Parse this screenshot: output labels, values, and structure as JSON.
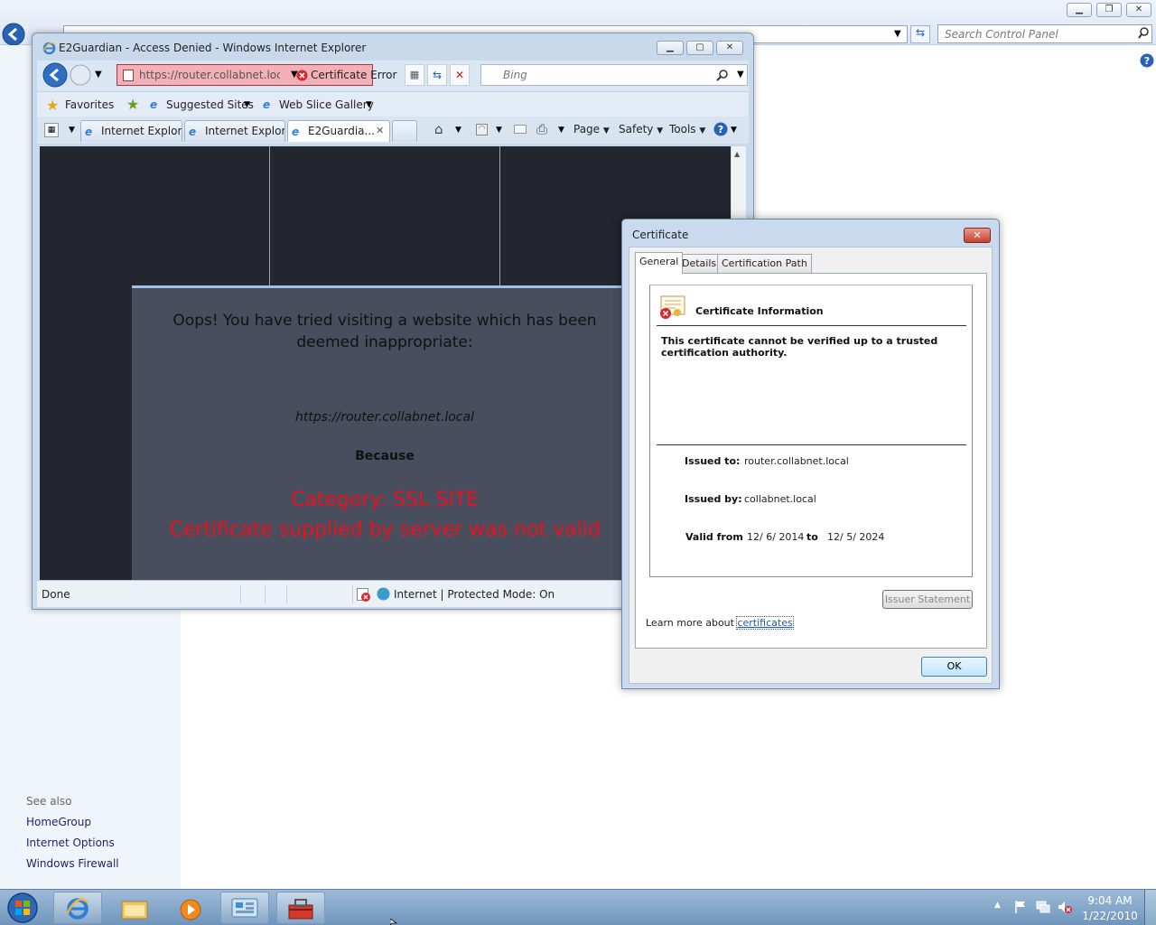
{
  "control_panel": {
    "search_placeholder": "Search Control Panel",
    "see_also_title": "See also",
    "see_also_links": [
      "HomeGroup",
      "Internet Options",
      "Windows Firewall"
    ]
  },
  "ie": {
    "title": "E2Guardian - Access Denied - Windows Internet Explorer",
    "url": "https://router.collabnet.local/p",
    "cert_error": "Certificate Error",
    "search_placeholder": "Bing",
    "favorites_bar": {
      "favorites": "Favorites",
      "suggested_sites": "Suggested Sites",
      "web_slice_gallery": "Web Slice Gallery"
    },
    "tabs": [
      {
        "label": "Internet Explor..."
      },
      {
        "label": "Internet Explor..."
      },
      {
        "label": "E2Guardia..."
      }
    ],
    "commands": {
      "page": "Page",
      "safety": "Safety",
      "tools": "Tools"
    },
    "content": {
      "heading_line1": "Oops! You have tried visiting a website which has been",
      "heading_line2": "deemed inappropriate:",
      "blocked_url": "https://router.collabnet.local",
      "because": "Because",
      "category": "Category: SSL SITE",
      "reason": "Certificate supplied by server was not valid"
    },
    "status": {
      "left": "Done",
      "zone": "Internet | Protected Mode: On"
    }
  },
  "certificate": {
    "title": "Certificate",
    "tabs": [
      "General",
      "Details",
      "Certification Path"
    ],
    "info_title": "Certificate Information",
    "warning": "This certificate cannot be verified up to a trusted certification authority.",
    "issued_to_label": "Issued to:",
    "issued_to": "router.collabnet.local",
    "issued_by_label": "Issued by:",
    "issued_by": "collabnet.local",
    "valid_from_label": "Valid from",
    "valid_from": "12/ 6/ 2014",
    "to_label": "to",
    "valid_to": "12/ 5/ 2024",
    "issuer_statement": "Issuer Statement",
    "learn_more_prefix": "Learn more about",
    "learn_more_link": "certificates",
    "ok": "OK"
  },
  "taskbar": {
    "time": "9:04 AM",
    "date": "1/22/2010"
  },
  "colors": {
    "error_red": "#e8111d",
    "content_dark": "#23252f",
    "block_box": "#484e5e",
    "cert_error_bg": "#f4b0b7"
  }
}
